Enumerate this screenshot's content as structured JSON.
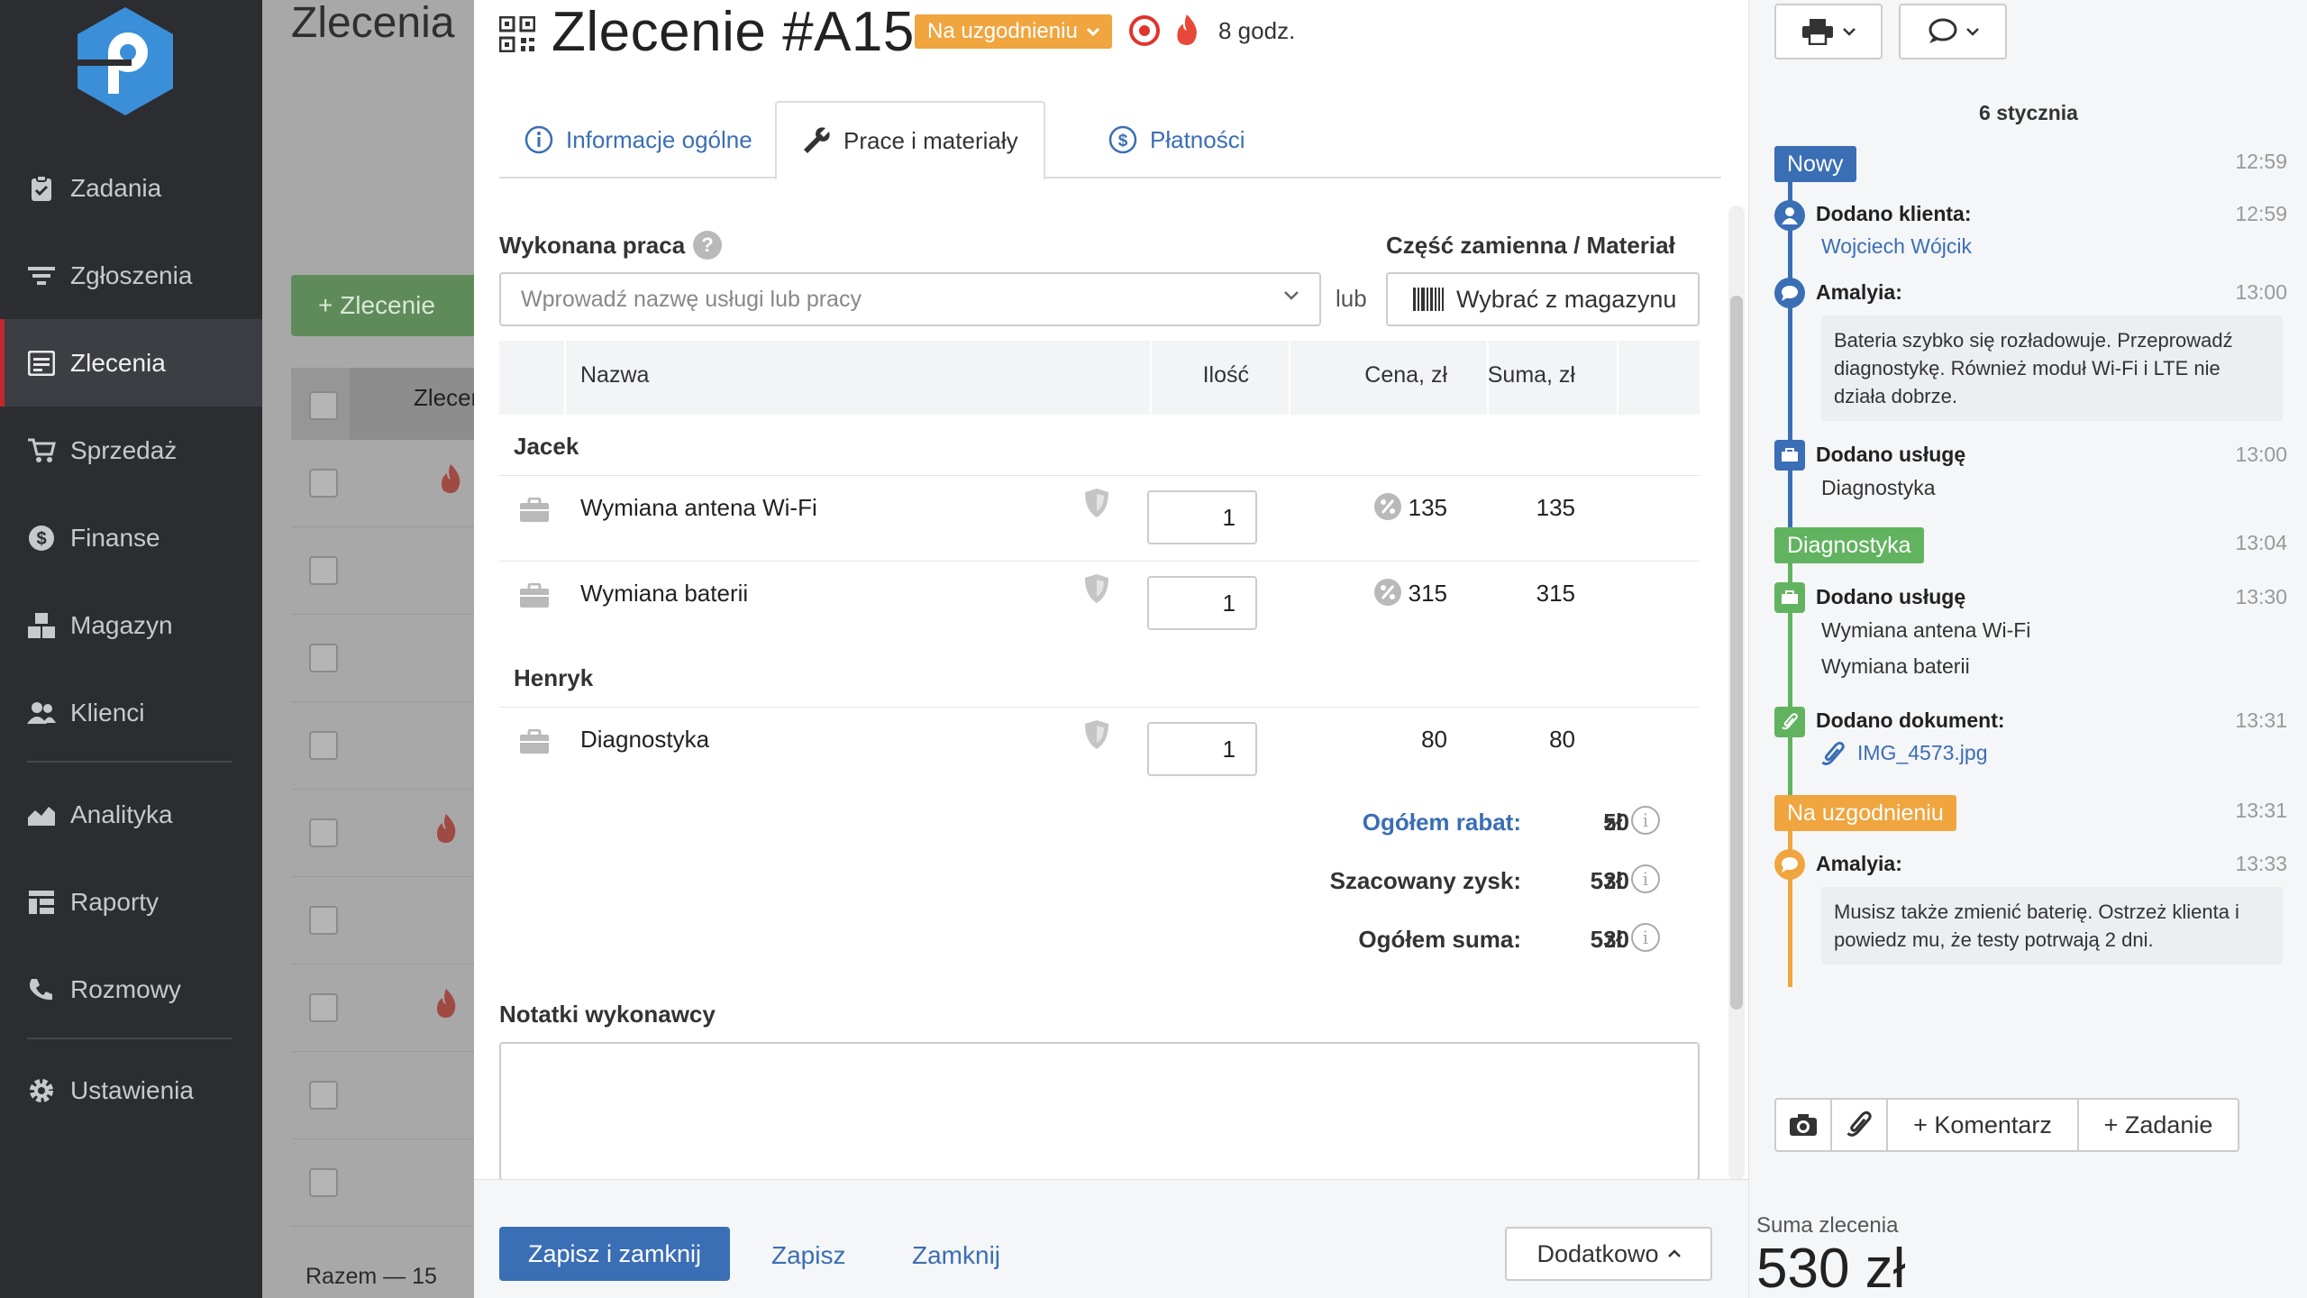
{
  "sidebar": {
    "items": [
      {
        "label": "Zadania",
        "icon": "clipboard-icon"
      },
      {
        "label": "Zgłoszenia",
        "icon": "filter-list-icon"
      },
      {
        "label": "Zlecenia",
        "icon": "orders-icon",
        "active": true
      },
      {
        "label": "Sprzedaż",
        "icon": "cart-icon"
      },
      {
        "label": "Finanse",
        "icon": "dollar-icon"
      },
      {
        "label": "Magazyn",
        "icon": "boxes-icon"
      },
      {
        "label": "Klienci",
        "icon": "users-icon"
      },
      {
        "label": "Analityka",
        "icon": "area-chart-icon"
      },
      {
        "label": "Raporty",
        "icon": "report-icon"
      },
      {
        "label": "Rozmowy",
        "icon": "phone-icon"
      },
      {
        "label": "Ustawienia",
        "icon": "gear-icon"
      }
    ]
  },
  "background": {
    "title": "Zlecenia",
    "add_button": "+ Zlecenie",
    "column_header": "Zlecenie",
    "footer": "Razem — 15"
  },
  "order": {
    "title": "Zlecenie #A15",
    "status": "Na uzgodnieniu",
    "time_left": "8 godz."
  },
  "tabs": [
    {
      "label": "Informacje ogólne",
      "icon": "info-icon"
    },
    {
      "label": "Prace i materiały",
      "icon": "wrench-icon",
      "active": true
    },
    {
      "label": "Płatności",
      "icon": "dollar-icon"
    }
  ],
  "work": {
    "label": "Wykonana praca",
    "help": "?",
    "select_placeholder": "Wprowadź nazwę usługi lub pracy",
    "or": "lub",
    "parts_label": "Część zamienna / Materiał",
    "warehouse_button": "Wybrać z magazynu"
  },
  "table": {
    "headers": {
      "name": "Nazwa",
      "qty": "Ilość",
      "price": "Cena, zł",
      "sum": "Suma, zł"
    },
    "groups": [
      {
        "name": "Jacek",
        "rows": [
          {
            "name": "Wymiana antena Wi-Fi",
            "qty": "1",
            "price": "135",
            "sum": "135",
            "discount": true
          },
          {
            "name": "Wymiana baterii",
            "qty": "1",
            "price": "315",
            "sum": "315",
            "discount": true
          }
        ]
      },
      {
        "name": "Henryk",
        "rows": [
          {
            "name": "Diagnostyka",
            "qty": "1",
            "price": "80",
            "sum": "80",
            "discount": false
          }
        ]
      }
    ]
  },
  "totals": {
    "discount_label": "Ogółem rabat:",
    "discount_value": "50",
    "profit_label": "Szacowany zysk:",
    "profit_value": "530",
    "total_label": "Ogółem suma:",
    "total_value": "530",
    "currency": "zł"
  },
  "notes": {
    "label": "Notatki wykonawcy",
    "value": ""
  },
  "footer": {
    "save_close": "Zapisz i zamknij",
    "save": "Zapisz",
    "close": "Zamknij",
    "more": "Dodatkowo"
  },
  "activity": {
    "date": "6 stycznia",
    "badge_new": "Nowy",
    "badge_new_time": "12:59",
    "ev1_title": "Dodano klienta:",
    "ev1_time": "12:59",
    "ev1_link": "Wojciech Wójcik",
    "ev2_title": "Amalyia:",
    "ev2_time": "13:00",
    "ev2_text": "Bateria szybko się rozładowuje. Przeprowadź diagnostykę. Również moduł Wi-Fi i LTE nie działa dobrze.",
    "ev3_title": "Dodano usługę",
    "ev3_time": "13:00",
    "ev3_text": "Diagnostyka",
    "badge_diag": "Diagnostyka",
    "badge_diag_time": "13:04",
    "ev4_title": "Dodano usługę",
    "ev4_time": "13:30",
    "ev4_text1": "Wymiana antena Wi-Fi",
    "ev4_text2": "Wymiana baterii",
    "ev5_title": "Dodano dokument:",
    "ev5_time": "13:31",
    "ev5_link": "IMG_4573.jpg",
    "badge_agree": "Na uzgodnieniu",
    "badge_agree_time": "13:31",
    "ev6_title": "Amalyia:",
    "ev6_time": "13:33",
    "ev6_text": "Musisz także zmienić baterię. Ostrzeż klienta i powiedz mu, że testy potrwają 2 dni.",
    "comment_button": "+ Komentarz",
    "task_button": "+ Zadanie",
    "sum_label": "Suma zlecenia",
    "sum_value": "530 zł"
  },
  "colors": {
    "accent": "#3a6eb5",
    "status_orange": "#f0a53f",
    "status_green": "#62b35f",
    "status_new": "#3a6eb5",
    "danger": "#e0342b"
  }
}
